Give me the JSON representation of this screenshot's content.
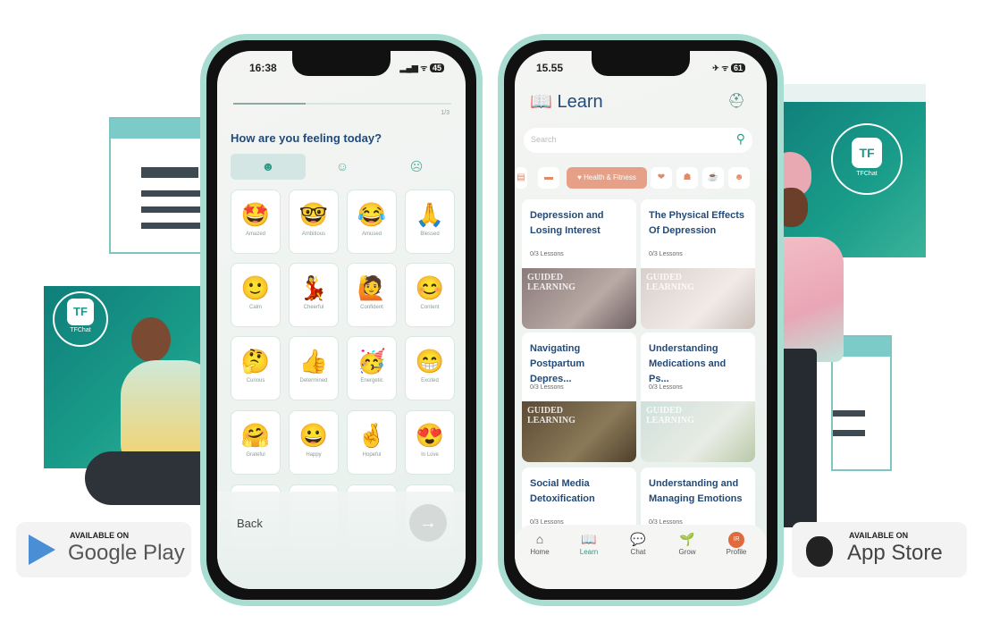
{
  "left_phone": {
    "status_time": "16:38",
    "battery": "45",
    "progress_label": "1/3",
    "progress": 0.33,
    "title": "How are you feeling today?",
    "mood_tabs": [
      "happy-face-icon",
      "neutral-face-icon",
      "sad-face-icon"
    ],
    "emotions": [
      {
        "glyph": "🤩",
        "label": "Amazed"
      },
      {
        "glyph": "🤓",
        "label": "Ambitious"
      },
      {
        "glyph": "😂",
        "label": "Amused"
      },
      {
        "glyph": "🙏",
        "label": "Blessed"
      },
      {
        "glyph": "🙂",
        "label": "Calm"
      },
      {
        "glyph": "💃",
        "label": "Cheerful"
      },
      {
        "glyph": "🙋",
        "label": "Confident"
      },
      {
        "glyph": "😊",
        "label": "Content"
      },
      {
        "glyph": "🤔",
        "label": "Curious"
      },
      {
        "glyph": "👍",
        "label": "Determined"
      },
      {
        "glyph": "🥳",
        "label": "Energetic"
      },
      {
        "glyph": "😁",
        "label": "Excited"
      },
      {
        "glyph": "🤗",
        "label": "Grateful"
      },
      {
        "glyph": "😀",
        "label": "Happy"
      },
      {
        "glyph": "🤞",
        "label": "Hopeful"
      },
      {
        "glyph": "😍",
        "label": "In Love"
      }
    ],
    "back_label": "Back",
    "next_icon": "arrow-right-icon"
  },
  "right_phone": {
    "status_time": "15.55",
    "battery": "61",
    "title": "Learn",
    "search_placeholder": "Search",
    "active_chip": "Health & Fitness",
    "cards": [
      {
        "title": "Depression and Losing Interest",
        "lessons": "0/3 Lessons",
        "image_text": "GUIDED LEARNING"
      },
      {
        "title": "The Physical Effects Of Depression",
        "lessons": "0/3 Lessons",
        "image_text": "GUIDED LEARNING"
      },
      {
        "title": "Navigating Postpartum Depres...",
        "lessons": "0/3 Lessons",
        "image_text": "GUIDED LEARNING"
      },
      {
        "title": "Understanding Medications and Ps...",
        "lessons": "0/3 Lessons",
        "image_text": "GUIDED LEARNING"
      },
      {
        "title": "Social Media Detoxification",
        "lessons": "0/3 Lessons"
      },
      {
        "title": "Understanding and Managing Emotions",
        "lessons": "0/3 Lessons"
      }
    ],
    "nav": [
      {
        "label": "Home",
        "icon": "⌂"
      },
      {
        "label": "Learn",
        "icon": "📖"
      },
      {
        "label": "Chat",
        "icon": "💬"
      },
      {
        "label": "Grow",
        "icon": "🌱"
      },
      {
        "label": "Profile",
        "icon": "IR"
      }
    ],
    "active_nav": "Learn"
  },
  "logo_text": "TFChat",
  "google_play": {
    "small": "AVAILABLE ON",
    "big": "Google Play"
  },
  "app_store": {
    "small": "AVAILABLE ON",
    "big": "App Store"
  },
  "colors": {
    "accent": "#2e9c86",
    "title": "#234a78",
    "chip": "#e6a088",
    "mint": "#a9ddd1"
  }
}
